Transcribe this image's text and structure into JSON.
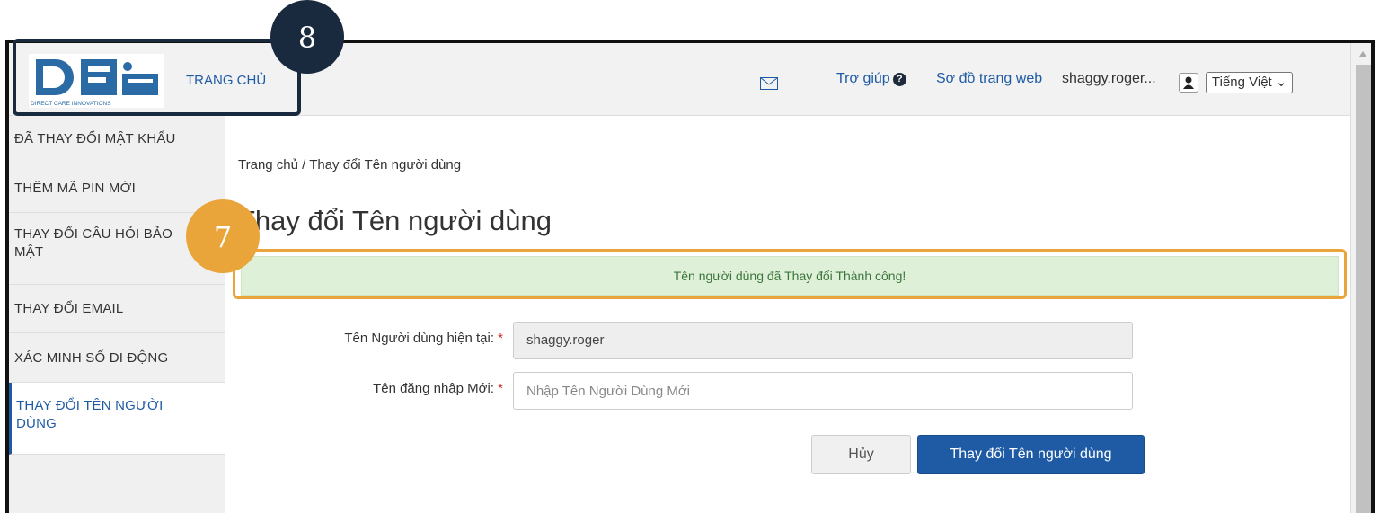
{
  "header": {
    "logo_caption": "DIRECT CARE INNOVATIONS",
    "home_label": "TRANG CHỦ",
    "mail_icon": "envelope-icon",
    "help_label": "Trợ giúp",
    "help_icon": "question-circle-icon",
    "sitemap_label": "Sơ đồ trang web",
    "username": "shaggy.roger...",
    "user_icon": "user-icon",
    "language": "Tiếng Việt"
  },
  "sidebar": {
    "items": [
      {
        "label": "ĐÃ THAY ĐỔI MẬT KHẨU"
      },
      {
        "label": "THÊM MÃ PIN MỚI"
      },
      {
        "label": "THAY ĐỔI CÂU HỎI BẢO MẬT"
      },
      {
        "label": "THAY ĐỔI EMAIL"
      },
      {
        "label": "XÁC MINH SỐ DI ĐỘNG"
      },
      {
        "label": "THAY ĐỔI TÊN NGƯỜI DÙNG"
      }
    ]
  },
  "main": {
    "breadcrumb": "Trang chủ / Thay đổi Tên người dùng",
    "title": "Thay đổi Tên người dùng",
    "alert": "Tên người dùng đã Thay đổi Thành công!",
    "current_label": "Tên Người dùng hiện tại:",
    "current_value": "shaggy.roger",
    "new_label": "Tên đăng nhập Mới:",
    "new_placeholder": "Nhập Tên Người Dùng Mới",
    "required_mark": "*",
    "cancel_label": "Hủy",
    "submit_label": "Thay đổi Tên người dùng"
  },
  "callouts": {
    "badge_8": "8",
    "badge_7": "7"
  },
  "colors": {
    "brand_blue": "#1f5ba5",
    "alert_green_bg": "#dff0d8",
    "callout_orange": "#e9a53a",
    "callout_navy": "#1a2a3e"
  }
}
